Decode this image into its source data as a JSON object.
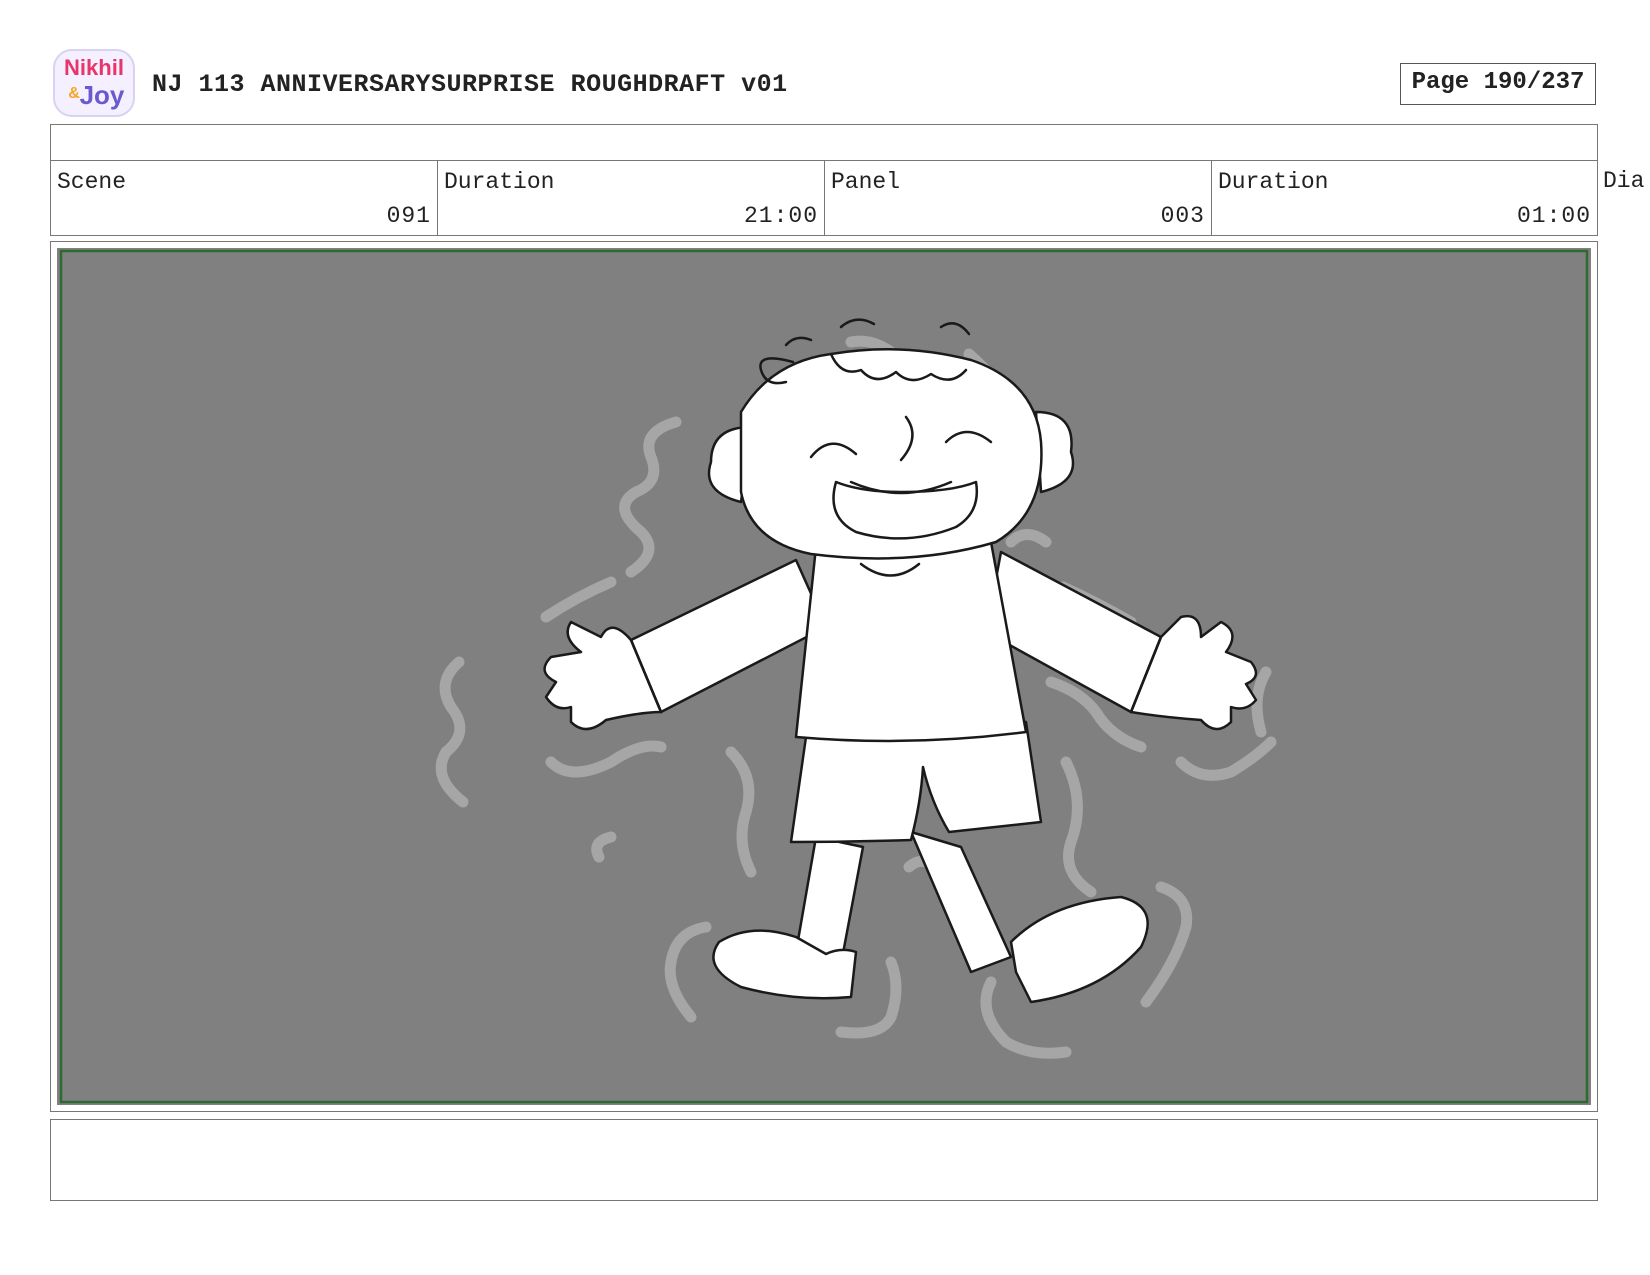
{
  "header": {
    "logo_text_top": "Nikhil",
    "logo_text_bottom": "Joy",
    "logo_amp": "&",
    "title": "NJ 113 ANNIVERSARYSURPRISE ROUGHDRAFT v01",
    "page_label": "Page 190/237"
  },
  "fields": {
    "scene_label": "Scene",
    "scene_value": "091",
    "scene_duration_label": "Duration",
    "scene_duration_value": "21:00",
    "panel_label": "Panel",
    "panel_value": "003",
    "panel_duration_label": "Duration",
    "panel_duration_value": "01:00",
    "dialogue_label": "Dia"
  },
  "colors": {
    "panel_background": "#808080",
    "safe_area_border": "#2e6b30",
    "effect_lines": "#a6a6a6",
    "character_fill": "#ffffff",
    "logo_pink": "#e8356a",
    "logo_purple": "#6a5acd",
    "logo_orange": "#f5a623"
  },
  "panel": {
    "image": "boy-lying-arms-spread-sketch",
    "notes": ""
  }
}
